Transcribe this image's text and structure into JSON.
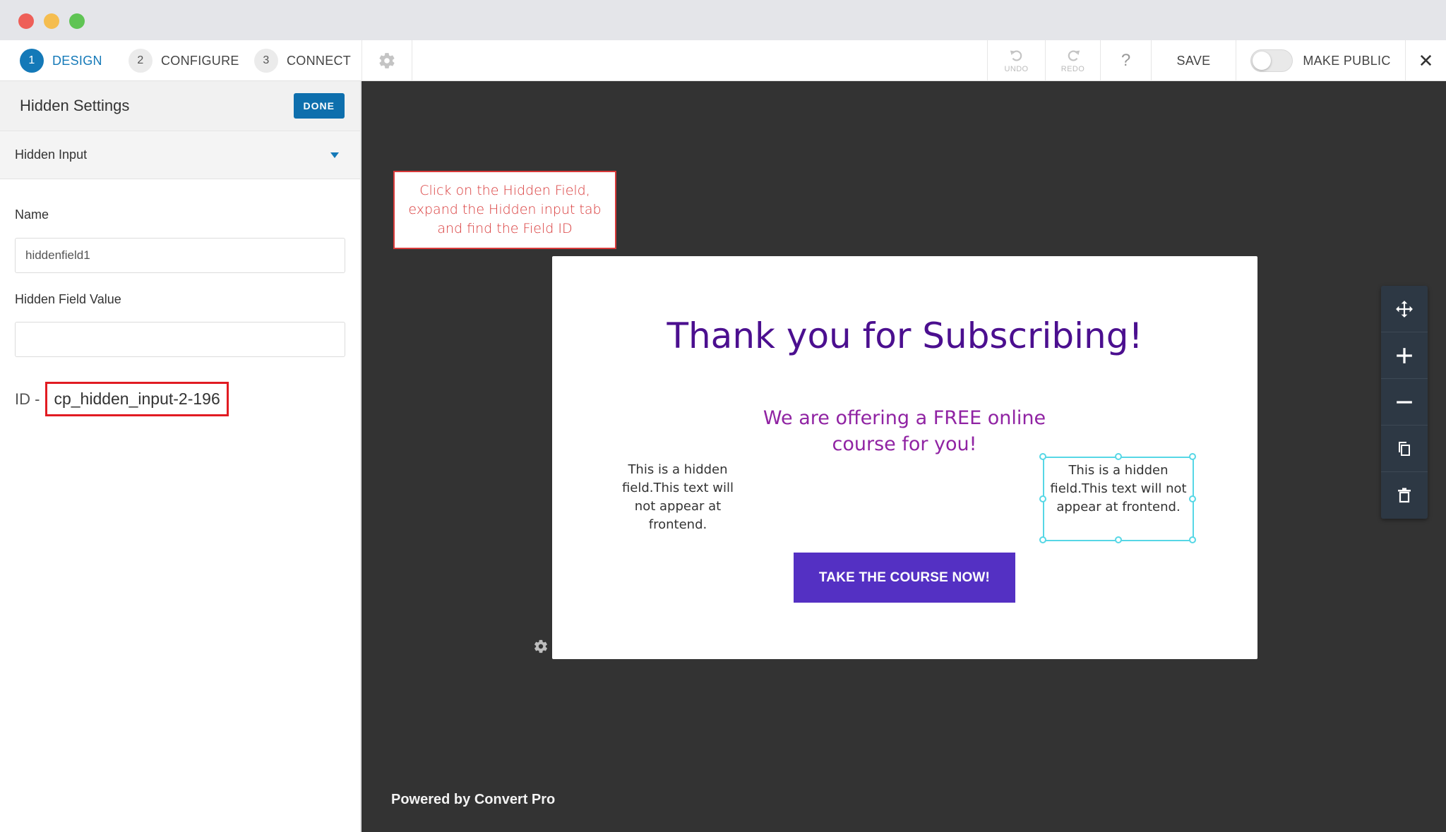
{
  "steps": [
    {
      "num": "1",
      "label": "DESIGN"
    },
    {
      "num": "2",
      "label": "CONFIGURE"
    },
    {
      "num": "3",
      "label": "CONNECT"
    }
  ],
  "toolbar": {
    "undo": "UNDO",
    "redo": "REDO",
    "help": "?",
    "save": "SAVE",
    "make_public": "MAKE PUBLIC",
    "close": "✕"
  },
  "sidebar": {
    "title": "Hidden Settings",
    "done": "DONE",
    "section": "Hidden Input",
    "name_label": "Name",
    "name_value": "hiddenfield1",
    "value_label": "Hidden Field Value",
    "value_value": "",
    "id_label": "ID -",
    "id_value": "cp_hidden_input-2-196"
  },
  "callout": {
    "line1": "Click on the Hidden Field,",
    "line2": "expand the Hidden input tab",
    "line3": "and find the Field ID"
  },
  "popup": {
    "heading": "Thank you for Subscribing!",
    "sub_line1": "We are offering a FREE online",
    "sub_line2": "course for you!",
    "hidden_left": "This is a hidden field.This text will not appear at frontend.",
    "hidden_right": "This is a hidden field.This text will not appear at frontend.",
    "cta": "TAKE THE COURSE NOW!"
  },
  "footer": {
    "powered": "Powered by Convert Pro"
  },
  "colors": {
    "accent": "#1479b8",
    "done": "#0e6fad",
    "heading": "#4b0f8f",
    "subheading": "#9023a3",
    "cta": "#5430c3",
    "callout": "#d93a3a",
    "id_highlight": "#e11b22",
    "canvas": "#333333"
  }
}
